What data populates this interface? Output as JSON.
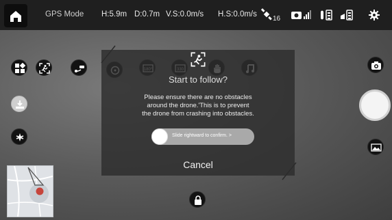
{
  "status_bar": {
    "mode": "GPS Mode",
    "height": "H:5.9m",
    "distance": "D:0.7m",
    "vertical_speed": "V.S:0.0m/s",
    "horizontal_speed": "H.S:0.0m/s",
    "satellite_count": "16"
  },
  "dialog": {
    "title": "Start to follow?",
    "message_line1": "Please ensure there are no obstacles",
    "message_line2": "around the drone.'This is to prevent",
    "message_line3": "the drone from crashing into obstacles.",
    "slider_label": "Slide rightward to confirm. >",
    "cancel_label": "Cancel"
  },
  "mode_icons": [
    "tracking-icon",
    "cable-icon",
    "circle-icon",
    "180-pano-icon",
    "330-pano-icon",
    "hand-icon",
    "music-icon"
  ],
  "colors": {
    "status_bg": "#1f1f1f",
    "dialog_bg": "#2d2d2d",
    "accent": "#ffffff"
  }
}
